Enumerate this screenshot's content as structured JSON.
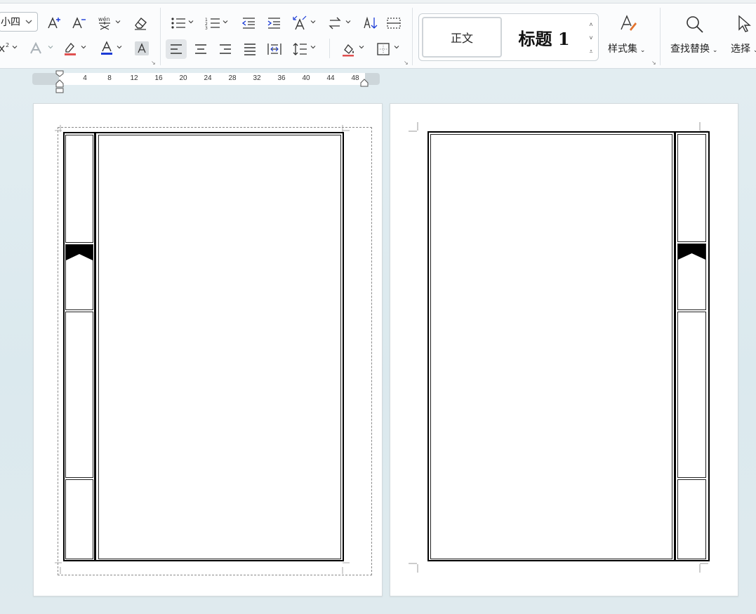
{
  "ribbon": {
    "font_size_value": "小四",
    "styles": {
      "normal": "正文",
      "heading1": "标题 1"
    },
    "style_set_label": "样式集",
    "find_replace_label": "查找替换",
    "select_label": "选择"
  },
  "ruler": {
    "ticks": [
      "4",
      "8",
      "12",
      "16",
      "20",
      "24",
      "28",
      "32",
      "36",
      "40",
      "44",
      "48"
    ]
  },
  "colors": {
    "font_color_bar": "#1b3bd6",
    "highlight_bar": "#e05050",
    "style_set_brush": "#e3742f"
  },
  "icons": [
    "grow-font-icon",
    "shrink-font-icon",
    "phonetic-guide-icon",
    "clear-format-icon",
    "superscript-icon",
    "text-effect-icon",
    "highlight-icon",
    "font-color-icon",
    "char-shading-icon",
    "bullets-icon",
    "numbering-icon",
    "decrease-indent-icon",
    "increase-indent-icon",
    "text-direction-icon",
    "ltr-rtl-icon",
    "sort-icon",
    "columns-icon",
    "align-left-icon",
    "align-center-icon",
    "align-right-icon",
    "justify-icon",
    "distributed-icon",
    "line-spacing-icon",
    "shading-icon",
    "borders-icon",
    "style-set-icon",
    "find-icon",
    "select-cursor-icon",
    "drag-handle-icon"
  ]
}
